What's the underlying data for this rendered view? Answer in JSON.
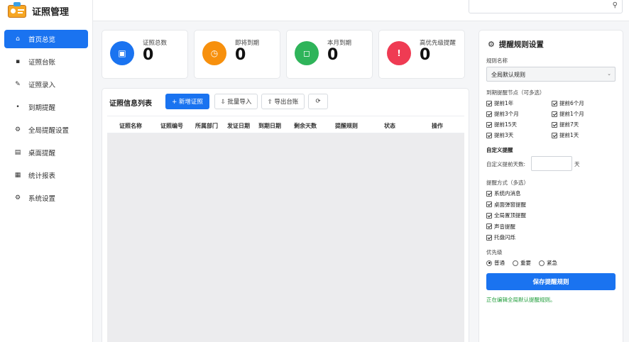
{
  "brand": {
    "title": "证照管理"
  },
  "sidebar": {
    "items": [
      {
        "label": "首页总览",
        "icon": "home-icon",
        "glyph": "⌂",
        "active": true
      },
      {
        "label": "证照台账",
        "icon": "id-card-icon",
        "glyph": "▪"
      },
      {
        "label": "证照录入",
        "icon": "pencil-icon",
        "glyph": "✎"
      },
      {
        "label": "到期提醒",
        "icon": "dot-icon",
        "glyph": "•"
      },
      {
        "label": "全局提醒设置",
        "icon": "gear-icon",
        "glyph": "⚙"
      },
      {
        "label": "桌面提醒",
        "icon": "monitor-icon",
        "glyph": "▤"
      },
      {
        "label": "统计报表",
        "icon": "chart-icon",
        "glyph": "▦"
      },
      {
        "label": "系统设置",
        "icon": "settings-icon",
        "glyph": "⚙"
      }
    ]
  },
  "search": {
    "placeholder": "",
    "icon": "search-icon"
  },
  "stats": [
    {
      "label": "证照总数",
      "value": "0",
      "color": "#1a73f0",
      "icon": "square-icon",
      "glyph": "▣"
    },
    {
      "label": "即将到期",
      "value": "0",
      "color": "#f7900d",
      "icon": "clock-icon",
      "glyph": "◷"
    },
    {
      "label": "本月到期",
      "value": "0",
      "color": "#2fb45a",
      "icon": "calendar-icon",
      "glyph": "◻"
    },
    {
      "label": "高优先级提醒",
      "value": "0",
      "color": "#ef3b53",
      "icon": "exclamation-icon",
      "glyph": "!"
    }
  ],
  "list": {
    "title": "证照信息列表",
    "add_label": "+ 新增证照",
    "import_label": "⇩ 批量导入",
    "export_label": "⇧ 导出台账",
    "refresh_glyph": "⟳",
    "columns": [
      "证照名称",
      "证照编号",
      "所属部门",
      "发证日期",
      "到期日期",
      "剩余天数",
      "提醒规则",
      "状态",
      "操作"
    ]
  },
  "rules": {
    "title": "提醒规则设置",
    "name_label": "规则名称",
    "name_value": "全局默认规则",
    "nodes_label": "到期提醒节点（可多选）",
    "nodes": [
      "提前1年",
      "提前6个月",
      "提前3个月",
      "提前1个月",
      "提前15天",
      "提前7天",
      "提前3天",
      "提前1天"
    ],
    "custom_title": "自定义提醒",
    "custom_label": "自定义提前天数:",
    "custom_unit": "天",
    "methods_label": "提醒方式（多选）",
    "methods": [
      "系统内消息",
      "桌面弹窗提醒",
      "全局置顶提醒",
      "声音提醒",
      "托盘闪烁"
    ],
    "priority_label": "优先级",
    "priorities": [
      "普通",
      "重要",
      "紧急"
    ],
    "priority_selected": "普通",
    "save_label": "保存提醒规则",
    "status": "正在编辑全局默认提醒规则。"
  }
}
